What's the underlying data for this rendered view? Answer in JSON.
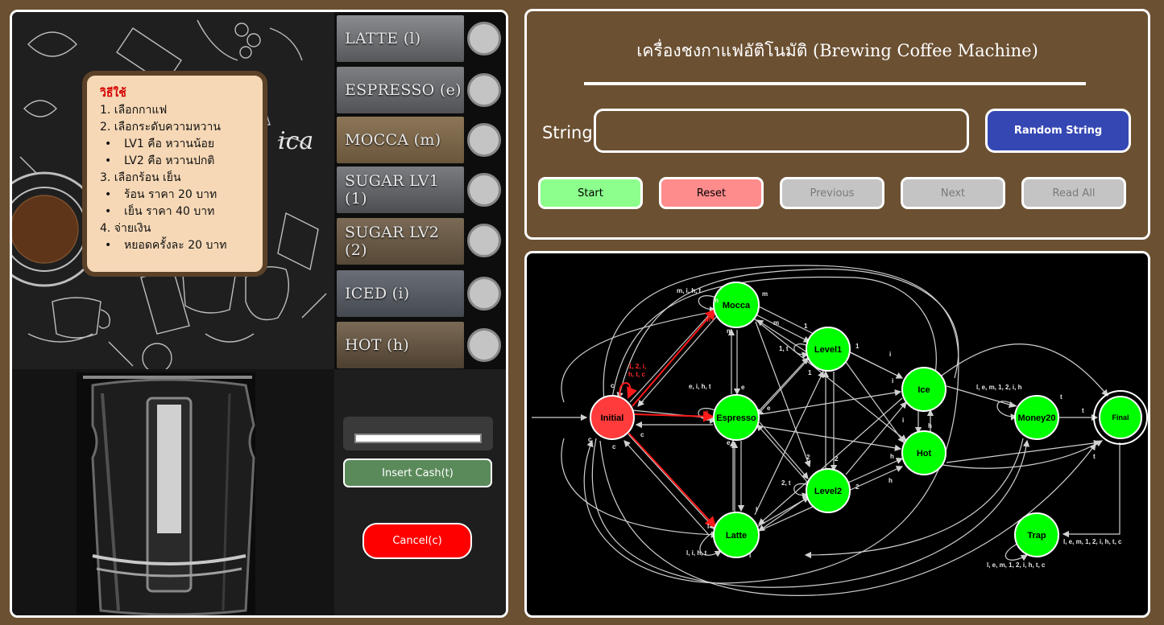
{
  "instructions": {
    "title": "วิธีใช้",
    "lines": [
      "1. เลือกกาแฟ",
      "2. เลือกระดับความหวาน",
      "LV1 คือ หวานน้อย",
      "LV2 คือ หวานปกติ",
      "3. เลือกร้อน เย็น",
      "ร้อน ราคา 20 บาท",
      "เย็น ราคา 40 บาท",
      "4. จ่ายเงิน",
      "หยอดครั้งละ 20 บาท"
    ]
  },
  "menu": {
    "items": [
      {
        "label": "LATTE (l)",
        "tint": "#77787a"
      },
      {
        "label": "ESPRESSO (e)",
        "tint": "#6f7072"
      },
      {
        "label": "MOCCA (m)",
        "tint": "#7a6850"
      },
      {
        "label": "SUGAR LV1 (1)",
        "tint": "#6a6c70"
      },
      {
        "label": "SUGAR LV2 (2)",
        "tint": "#6b5e4c"
      },
      {
        "label": "ICED (i)",
        "tint": "#5c6068"
      },
      {
        "label": "HOT (h)",
        "tint": "#6a5a46"
      }
    ]
  },
  "controls": {
    "insert_cash": "Insert Cash(t)",
    "cancel": "Cancel(c)"
  },
  "header": {
    "title": "เครื่องชงกาแฟอัติโนมัติ (Brewing Coffee Machine)",
    "string_label": "String:",
    "string_value": "",
    "random_button": "Random String"
  },
  "buttons": {
    "start": "Start",
    "reset": "Reset",
    "previous": "Previous",
    "next": "Next",
    "read_all": "Read All"
  },
  "colors": {
    "background": "#6b5032",
    "start_button": "#8dff8d",
    "reset_button": "#ff8c8c",
    "disabled_button": "#c4c4c4",
    "random_button": "#3547b3",
    "state_active": "#00ff00",
    "state_current": "#ff3b3b"
  },
  "graph": {
    "states": {
      "initial": "Initial",
      "mocca": "Mocca",
      "espresso": "Espresso",
      "latte": "Latte",
      "level1": "Level1",
      "level2": "Level2",
      "ice": "Ice",
      "hot": "Hot",
      "money20": "Money20",
      "final": "Final",
      "trap": "Trap"
    },
    "edge_labels": {
      "mocca_loop": "m, i, h, t",
      "espresso_loop": "e, i, h, t",
      "latte_loop": "l, i, h, t",
      "init_self": "1, 2, i,",
      "init_self2": "h, t, c",
      "money_loop": "l, e, m, 1, 2, i, h",
      "trap_loop": "l, e, m, 1, 2, i, h, t, c",
      "final_trap": "l, e, m, 1, 2, i, h, t, c",
      "l1_loop": "1, t",
      "l2_loop": "2, t",
      "m": "m",
      "e": "e",
      "l": "l",
      "c": "c",
      "one": "1",
      "two": "2",
      "i": "i",
      "h": "h",
      "t": "t"
    }
  }
}
